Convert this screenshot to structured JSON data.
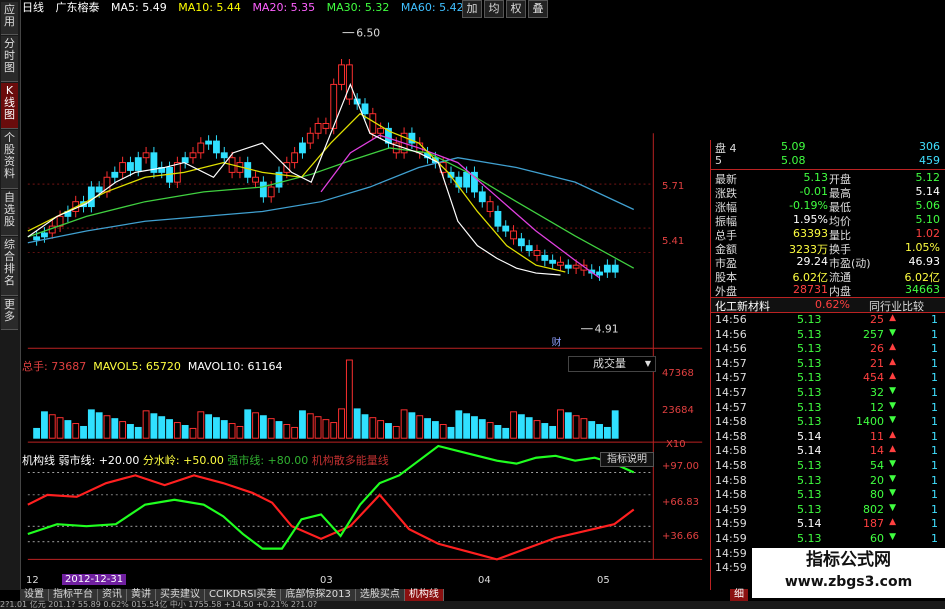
{
  "left_tabs": [
    {
      "label": "应用",
      "active": false
    },
    {
      "label": "分时图",
      "active": false
    },
    {
      "label": "K线图",
      "active": true
    },
    {
      "label": "个股资料",
      "active": false
    },
    {
      "label": "自选股",
      "active": false
    },
    {
      "label": "综合排名",
      "active": false
    },
    {
      "label": "更多",
      "active": false
    }
  ],
  "kline_header": {
    "period": "日线",
    "stock_name": "广东榕泰",
    "ma5": "MA5: 5.49",
    "ma10": "MA10: 5.44",
    "ma20": "MA20: 5.35",
    "ma30": "MA30: 5.32",
    "ma60": "MA60: 5.42"
  },
  "top_right_tabs": [
    "加",
    "均",
    "权",
    "叠"
  ],
  "price_axis": [
    "5.71",
    "5.41"
  ],
  "annotations": {
    "high": "6.50",
    "low": "4.91",
    "fin_marker": "财"
  },
  "volume_header": {
    "total": "总手: 73687",
    "mavol5": "MAVOL5: 65720",
    "mavol10": "MAVOL10: 61164",
    "selector": "成交量"
  },
  "volume_axis": [
    "47368",
    "23684",
    "X10"
  ],
  "indicator_header": {
    "name": "机构线",
    "weak": "弱市线: +20.00",
    "mid": "分水岭: +50.00",
    "strong": "强市线: +80.00",
    "extra": "机构散多能量线",
    "help": "指标说明"
  },
  "indicator_axis": [
    "+97.00",
    "+66.83",
    "+36.66"
  ],
  "date_axis": [
    "12",
    "03",
    "04",
    "05"
  ],
  "date_cursor": "2012-12-31",
  "quote": {
    "ask_rows": [
      {
        "label": "盘 4",
        "price": "5.09",
        "vol": "306"
      },
      {
        "label": "5",
        "price": "5.08",
        "vol": "459"
      }
    ],
    "rows": [
      {
        "l1": "最新",
        "v1": "5.13",
        "c1": "down",
        "l2": "开盘",
        "v2": "5.12",
        "c2": "down"
      },
      {
        "l1": "涨跌",
        "v1": "-0.01",
        "c1": "down",
        "l2": "最高",
        "v2": "5.14",
        "c2": "white"
      },
      {
        "l1": "涨幅",
        "v1": "-0.19%",
        "c1": "down",
        "l2": "最低",
        "v2": "5.06",
        "c2": "down"
      },
      {
        "l1": "振幅",
        "v1": "1.95%",
        "c1": "white",
        "l2": "均价",
        "v2": "5.10",
        "c2": "down"
      },
      {
        "l1": "总手",
        "v1": "63393",
        "c1": "yellow",
        "l2": "量比",
        "v2": "1.02",
        "c2": "up"
      },
      {
        "l1": "金额",
        "v1": "3233万",
        "c1": "yellow",
        "l2": "换手",
        "v2": "1.05%",
        "c2": "yellow"
      },
      {
        "l1": "市盈",
        "v1": "29.24",
        "c1": "white",
        "l2": "市盈(动)",
        "v2": "46.93",
        "c2": "white"
      },
      {
        "l1": "股本",
        "v1": "6.02亿",
        "c1": "yellow",
        "l2": "流通",
        "v2": "6.02亿",
        "c2": "yellow"
      },
      {
        "l1": "外盘",
        "v1": "28731",
        "c1": "up",
        "l2": "内盘",
        "v2": "34663",
        "c2": "down"
      }
    ],
    "sector": {
      "name": "化工新材料",
      "change": "0.62%",
      "button": "同行业比较"
    }
  },
  "ticks": [
    {
      "time": "14:56",
      "price": "5.13",
      "pc": "down",
      "vol": "25",
      "dir": "up"
    },
    {
      "time": "14:56",
      "price": "5.13",
      "pc": "down",
      "vol": "257",
      "dir": "down"
    },
    {
      "time": "14:56",
      "price": "5.13",
      "pc": "down",
      "vol": "26",
      "dir": "up"
    },
    {
      "time": "14:57",
      "price": "5.13",
      "pc": "down",
      "vol": "21",
      "dir": "up"
    },
    {
      "time": "14:57",
      "price": "5.13",
      "pc": "down",
      "vol": "454",
      "dir": "up"
    },
    {
      "time": "14:57",
      "price": "5.13",
      "pc": "down",
      "vol": "32",
      "dir": "down"
    },
    {
      "time": "14:57",
      "price": "5.13",
      "pc": "down",
      "vol": "12",
      "dir": "down"
    },
    {
      "time": "14:58",
      "price": "5.13",
      "pc": "down",
      "vol": "1400",
      "dir": "down"
    },
    {
      "time": "14:58",
      "price": "5.14",
      "pc": "white",
      "vol": "11",
      "dir": "up"
    },
    {
      "time": "14:58",
      "price": "5.14",
      "pc": "white",
      "vol": "14",
      "dir": "up"
    },
    {
      "time": "14:58",
      "price": "5.13",
      "pc": "down",
      "vol": "54",
      "dir": "down"
    },
    {
      "time": "14:58",
      "price": "5.13",
      "pc": "down",
      "vol": "20",
      "dir": "down"
    },
    {
      "time": "14:58",
      "price": "5.13",
      "pc": "down",
      "vol": "80",
      "dir": "down"
    },
    {
      "time": "14:59",
      "price": "5.13",
      "pc": "down",
      "vol": "802",
      "dir": "down"
    },
    {
      "time": "14:59",
      "price": "5.14",
      "pc": "white",
      "vol": "187",
      "dir": "up"
    },
    {
      "time": "14:59",
      "price": "5.13",
      "pc": "down",
      "vol": "60",
      "dir": "down"
    },
    {
      "time": "14:59",
      "price": "",
      "pc": "down",
      "vol": "",
      "dir": ""
    },
    {
      "time": "14:59",
      "price": "",
      "pc": "down",
      "vol": "",
      "dir": ""
    }
  ],
  "bottom_tabs": [
    {
      "label": "设置",
      "active": false
    },
    {
      "label": "指标平台",
      "active": false
    },
    {
      "label": "资讯",
      "active": false
    },
    {
      "label": "黄讲",
      "active": false
    },
    {
      "label": "买卖建议",
      "active": false
    },
    {
      "label": "CCIKDRSI买卖",
      "active": false
    },
    {
      "label": "底部惊探2013",
      "active": false
    },
    {
      "label": "选股买点",
      "active": false
    },
    {
      "label": "机构线",
      "active": true
    }
  ],
  "bottom_right_tab": "细",
  "status_bar": "2?1.01 亿元  201.1? 55.89 0.62% 015.54亿 中小 1755.58 +14.50 +0.21%  2?1.0?",
  "watermark": {
    "line1": "指标公式网",
    "line2": "www.zbgs3.com"
  },
  "colors": {
    "up": "#ff3030",
    "down": "#30e030",
    "ma5": "#ffffff",
    "ma10": "#ffff00",
    "ma20": "#ff40ff",
    "ma30": "#40ff40",
    "ma60": "#40c0ff",
    "accent": "#b22222"
  }
}
